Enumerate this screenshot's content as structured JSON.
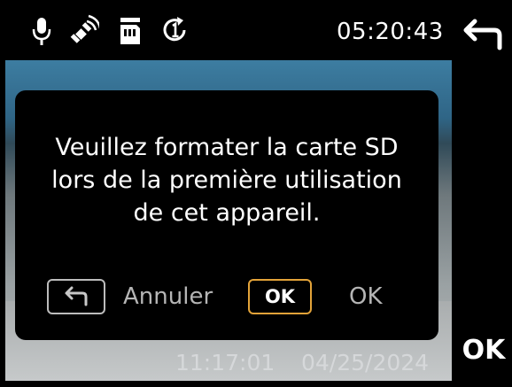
{
  "status_bar": {
    "icons": [
      "microphone-icon",
      "gps-satellite-icon",
      "sd-card-icon",
      "loop-recording-1-icon"
    ],
    "time": "05:20:43"
  },
  "right_panel": {
    "back_icon": "back-arrow-icon",
    "ok_label": "OK"
  },
  "dialog": {
    "message_lines": [
      "Veuillez formater la carte SD",
      "lors de la première utilisation",
      "de cet appareil."
    ],
    "cancel_key_icon": "back-arrow-icon",
    "cancel_label": "Annuler",
    "ok_key_label": "OK",
    "ok_label": "OK",
    "accent_color": "#e3a339"
  },
  "preview": {
    "time": "11:17:01",
    "date": "04/25/2024"
  }
}
